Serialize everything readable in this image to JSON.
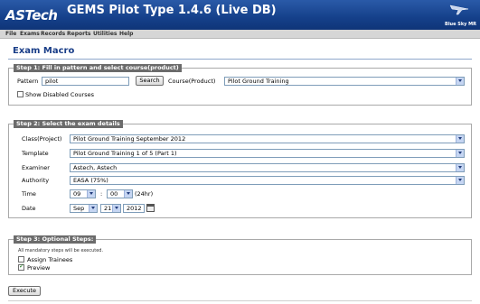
{
  "header": {
    "logo": "ASTech",
    "title": "GEMS Pilot Type 1.4.6 (Live DB)",
    "brand": "Blue Sky MR"
  },
  "menu": [
    "File",
    "Exams",
    "Records",
    "Reports",
    "Utilities",
    "Help"
  ],
  "page_title": "Exam Macro",
  "step1": {
    "legend": "Step 1: Fill in pattern and select course(product)",
    "pattern_label": "Pattern",
    "pattern_value": "pilot",
    "search_label": "Search",
    "course_label": "Course(Product)",
    "course_value": "Pilot Ground Training",
    "show_disabled_label": "Show Disabled Courses",
    "show_disabled_checked": false
  },
  "step2": {
    "legend": "Step 2: Select the exam details",
    "class_label": "Class(Project)",
    "class_value": "Pilot Ground Training September 2012",
    "template_label": "Template",
    "template_value": "Pilot Ground Training 1 of 5 (Part 1)",
    "examiner_label": "Examiner",
    "examiner_value": "Astech, Astech",
    "authority_label": "Authority",
    "authority_value": "EASA (75%)",
    "time_label": "Time",
    "time_hour": "09",
    "time_sep": ":",
    "time_min": "00",
    "time_suffix": "(24hr)",
    "date_label": "Date",
    "date_month": "Sep",
    "date_day": "21",
    "date_year": "2012"
  },
  "step3": {
    "legend": "Step 3: Optional Steps:",
    "note": "All mandatory steps will be executed.",
    "assign_label": "Assign Trainees",
    "assign_checked": false,
    "preview_label": "Preview",
    "preview_checked": true
  },
  "execute_label": "Execute",
  "colors": {
    "header": "#15408a",
    "title": "#1a3e88",
    "legend": "#6b6b6b"
  },
  "icons": [
    "plane-logo-icon",
    "calendar-icon",
    "dropdown-arrow-icon"
  ]
}
